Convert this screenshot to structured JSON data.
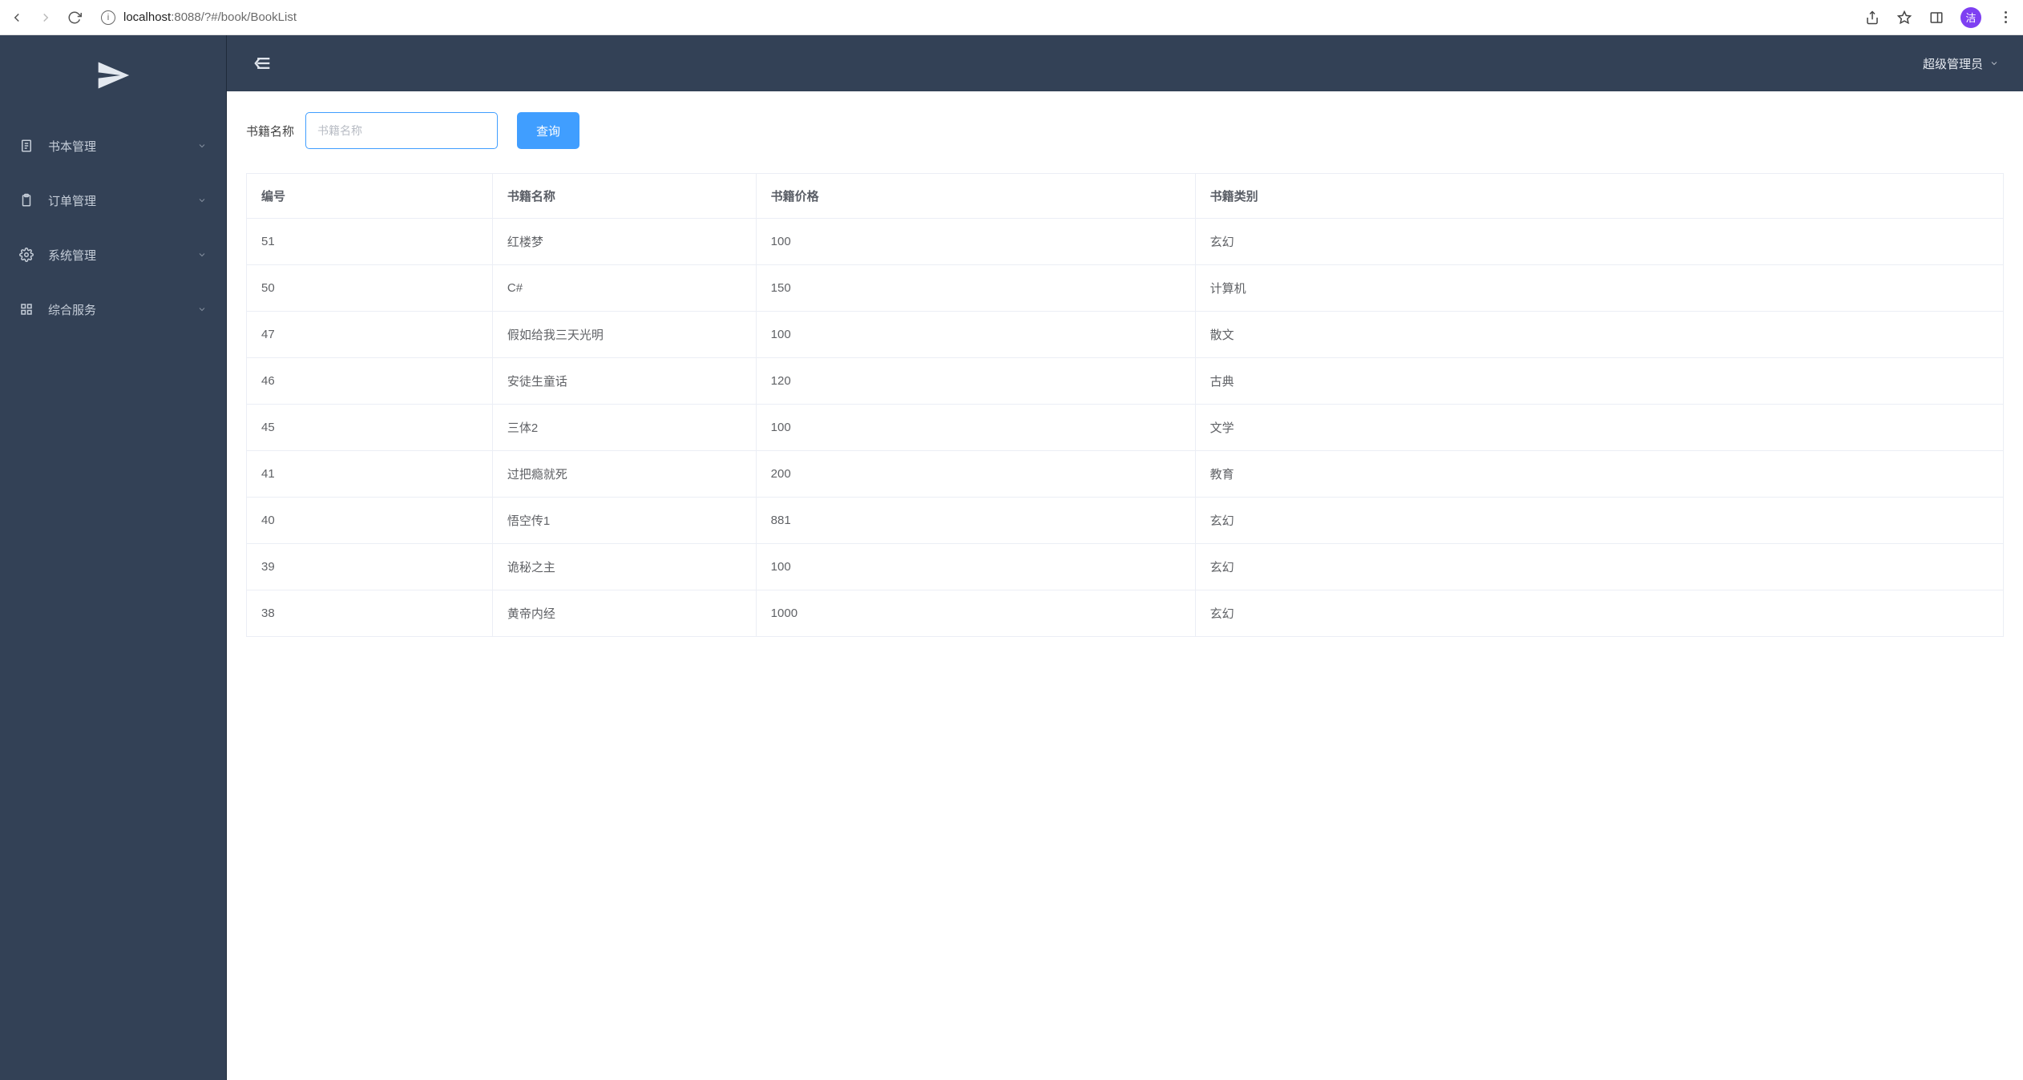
{
  "browser": {
    "url_host": "localhost",
    "url_port_path": ":8088/?#/book/BookList",
    "avatar_text": "洁"
  },
  "sidebar": {
    "items": [
      {
        "label": "书本管理",
        "icon": "doc"
      },
      {
        "label": "订单管理",
        "icon": "clipboard"
      },
      {
        "label": "系统管理",
        "icon": "gear"
      },
      {
        "label": "综合服务",
        "icon": "grid"
      }
    ]
  },
  "topbar": {
    "user_label": "超级管理员"
  },
  "search": {
    "label": "书籍名称",
    "placeholder": "书籍名称",
    "value": "",
    "button_label": "查询"
  },
  "table": {
    "columns": [
      "编号",
      "书籍名称",
      "书籍价格",
      "书籍类别"
    ],
    "rows": [
      {
        "id": "51",
        "name": "红楼梦",
        "price": "100",
        "category": "玄幻"
      },
      {
        "id": "50",
        "name": "C#",
        "price": "150",
        "category": "计算机"
      },
      {
        "id": "47",
        "name": "假如给我三天光明",
        "price": "100",
        "category": "散文"
      },
      {
        "id": "46",
        "name": "安徒生童话",
        "price": "120",
        "category": "古典"
      },
      {
        "id": "45",
        "name": "三体2",
        "price": "100",
        "category": "文学"
      },
      {
        "id": "41",
        "name": "过把瘾就死",
        "price": "200",
        "category": "教育"
      },
      {
        "id": "40",
        "name": "悟空传1",
        "price": "881",
        "category": "玄幻"
      },
      {
        "id": "39",
        "name": "诡秘之主",
        "price": "100",
        "category": "玄幻"
      },
      {
        "id": "38",
        "name": "黄帝内经",
        "price": "1000",
        "category": "玄幻"
      }
    ]
  }
}
